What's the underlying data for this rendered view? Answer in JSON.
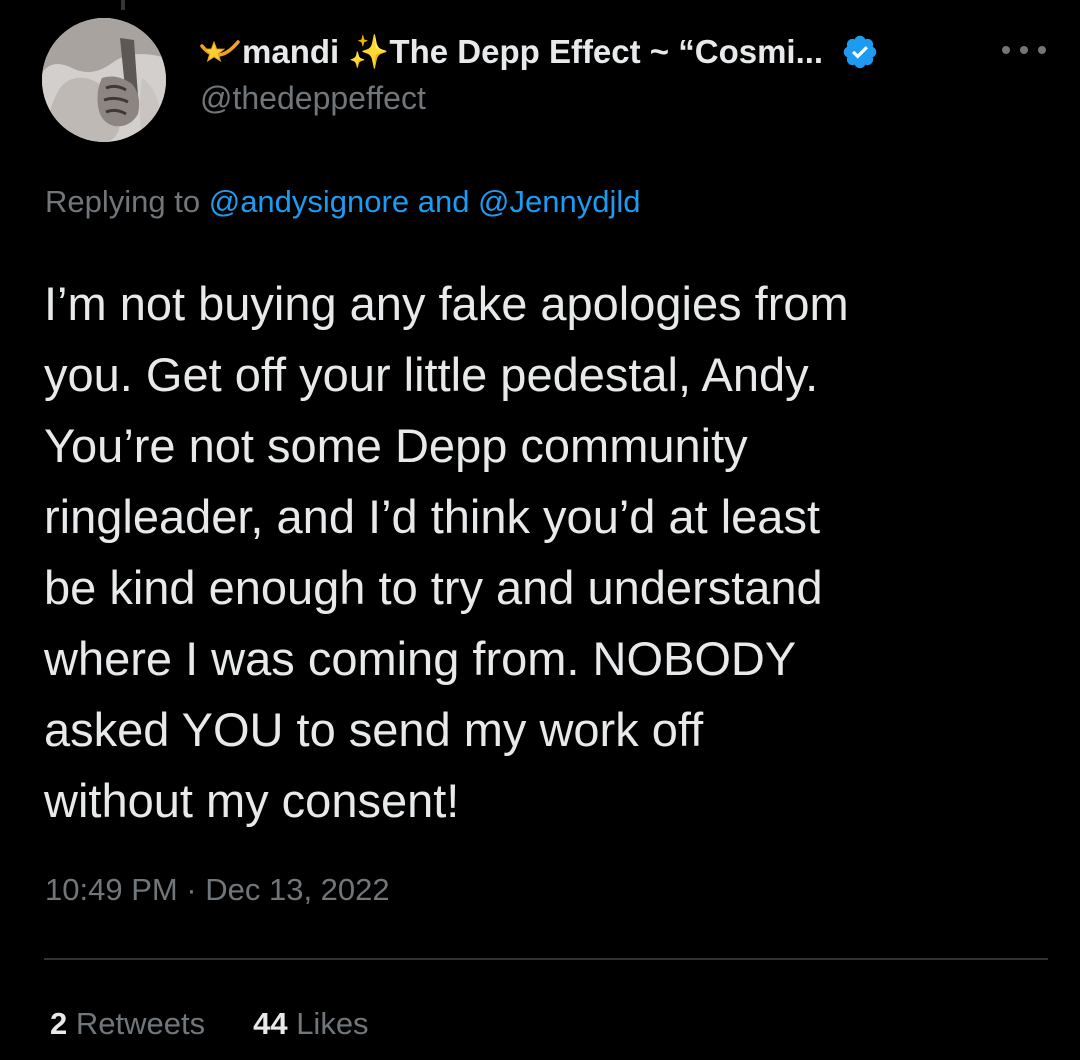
{
  "tweet": {
    "author": {
      "display_name": "mandi ✨The Depp Effect ~ “Cosmi...",
      "handle": "@thedeppeffect",
      "verified": true,
      "name_prefix_icon": "shooting-star-emoji"
    },
    "replying_to": {
      "prefix": "Replying to ",
      "user1": "@andysignore",
      "conjunction": " and ",
      "user2": "@Jennydjld"
    },
    "text_lines": [
      "I’m not buying any fake apologies from",
      "you. Get off your little pedestal, Andy.",
      "You’re not some Depp community",
      "ringleader, and I’d think you’d at least",
      "be kind enough to try and understand",
      "where I was coming from. NOBODY",
      "asked YOU to send my work off",
      "without my consent!"
    ],
    "timestamp": "10:49 PM · Dec 13, 2022",
    "stats": {
      "retweets_count": "2",
      "retweets_label": " Retweets",
      "likes_count": "44",
      "likes_label": " Likes"
    }
  },
  "colors": {
    "background": "#000000",
    "primary_text": "#e7e9ea",
    "secondary_text": "#71767b",
    "link": "#1d9bf0",
    "divider": "#2f3336"
  },
  "icons": [
    "avatar-photo",
    "shooting-star-emoji",
    "verified-badge-icon",
    "more-options-icon"
  ]
}
